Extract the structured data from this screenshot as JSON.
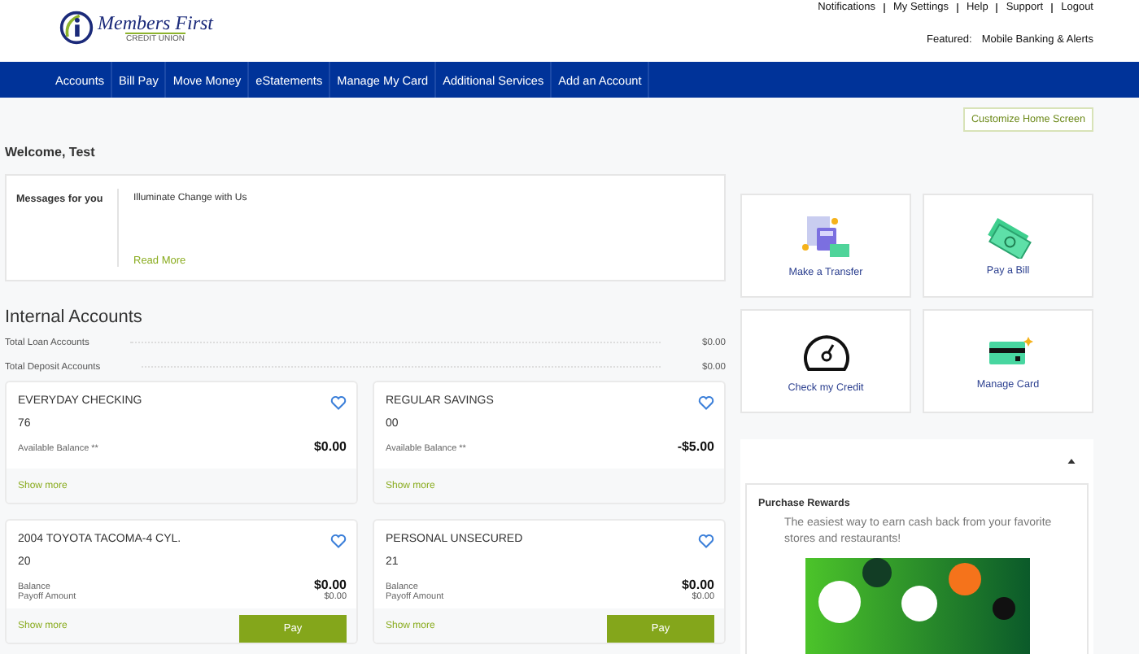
{
  "header": {
    "logo_text": "Members First",
    "logo_subtext": "CREDIT UNION",
    "top_links": [
      "Notifications",
      "My Settings",
      "Help",
      "Support",
      "Logout"
    ],
    "featured_label": "Featured:",
    "featured_link": "Mobile Banking & Alerts"
  },
  "nav": [
    "Accounts",
    "Bill Pay",
    "Move Money",
    "eStatements",
    "Manage My Card",
    "Additional Services",
    "Add an Account"
  ],
  "customize_button": "Customize Home Screen",
  "welcome": "Welcome, Test",
  "messages": {
    "label": "Messages for you",
    "text": "Illuminate Change with Us",
    "link": "Read More"
  },
  "internal_accounts": {
    "title": "Internal Accounts",
    "totals": [
      {
        "label": "Total Loan Accounts",
        "value": "$0.00"
      },
      {
        "label": "Total Deposit Accounts",
        "value": "$0.00"
      }
    ],
    "accounts": [
      {
        "kind": "deposit",
        "name": "EVERYDAY CHECKING",
        "number": "76",
        "rows": [
          {
            "label": "Available Balance **",
            "value": "$0.00"
          }
        ],
        "show_more": "Show more"
      },
      {
        "kind": "deposit",
        "name": "REGULAR SAVINGS",
        "number": "00",
        "rows": [
          {
            "label": "Available Balance **",
            "value": "-$5.00"
          }
        ],
        "show_more": "Show more"
      },
      {
        "kind": "loan",
        "name": "2004 TOYOTA TACOMA-4 CYL.",
        "number": "20",
        "rows": [
          {
            "label": "Balance",
            "value": "$0.00"
          },
          {
            "label": "Payoff Amount",
            "value": "$0.00"
          }
        ],
        "show_more": "Show more",
        "pay": "Pay"
      },
      {
        "kind": "loan",
        "name": "PERSONAL UNSECURED",
        "number": "21",
        "rows": [
          {
            "label": "Balance",
            "value": "$0.00"
          },
          {
            "label": "Payoff Amount",
            "value": "$0.00"
          }
        ],
        "show_more": "Show more",
        "pay": "Pay"
      }
    ]
  },
  "quick_actions": [
    {
      "kind": "transfer",
      "label": "Make a Transfer"
    },
    {
      "kind": "bill",
      "label": "Pay a Bill"
    },
    {
      "kind": "credit",
      "label": "Check my Credit"
    },
    {
      "kind": "card",
      "label": "Manage Card"
    }
  ],
  "rewards": {
    "expanded": true,
    "title": "Purchase Rewards",
    "text": "The easiest way to earn cash back from your favorite stores and restaurants!"
  }
}
